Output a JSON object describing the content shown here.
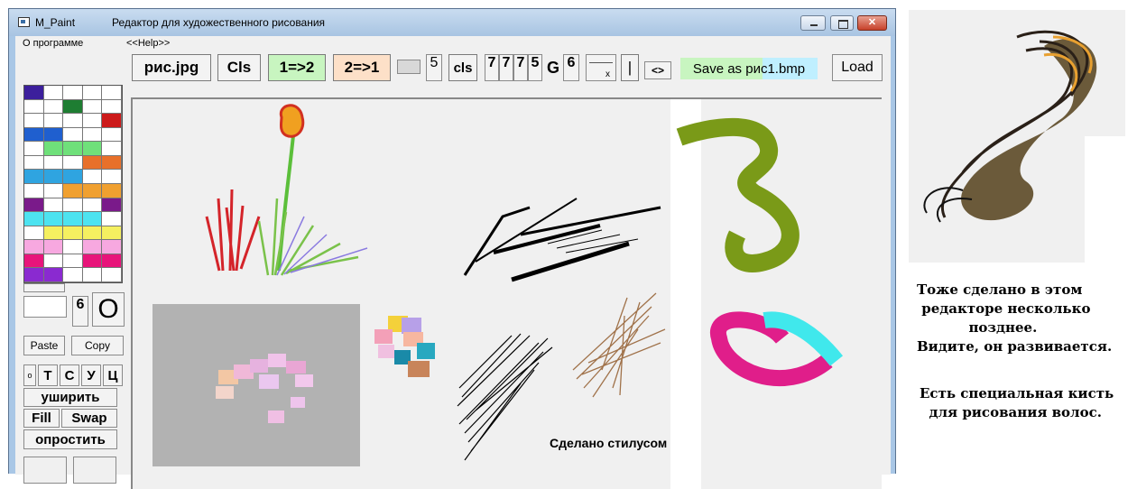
{
  "window": {
    "app_name": "M_Paint",
    "description": "Редактор для художественного рисования"
  },
  "menu": {
    "about": "О программе",
    "help": "<<Help>>"
  },
  "toolbar": {
    "open_jpg": "рис.jpg",
    "cls_upper": "Cls",
    "one_to_two": "1=>2",
    "two_to_one": "2=>1",
    "brush_size_value": "5",
    "cls_lower": "cls",
    "digits": [
      "7",
      "7",
      "7",
      "5"
    ],
    "g_label": "G",
    "g_value": "6",
    "x_label": "x",
    "bar_label": "|",
    "swap_arrows": "<>",
    "save_as": "Save as рис1.bmp",
    "load": "Load"
  },
  "left_panel": {
    "size_value": "6",
    "shape_label": "O",
    "paste": "Paste",
    "copy": "Copy",
    "letters": [
      "o",
      "Т",
      "С",
      "У",
      "Ц"
    ],
    "widen": "уширить",
    "fill": "Fill",
    "swap": "Swap",
    "simplify": "опростить"
  },
  "palette_colors": [
    "#3c1f9c",
    "#ffffff",
    "#ffffff",
    "#ffffff",
    "#ffffff",
    "#ffffff",
    "#ffffff",
    "#1e7d32",
    "#ffffff",
    "#ffffff",
    "#ffffff",
    "#ffffff",
    "#ffffff",
    "#ffffff",
    "#cc1a1a",
    "#1f5fcf",
    "#1f5fcf",
    "#ffffff",
    "#ffffff",
    "#ffffff",
    "#ffffff",
    "#6fe07a",
    "#6fe07a",
    "#6fe07a",
    "#ffffff",
    "#ffffff",
    "#ffffff",
    "#ffffff",
    "#e8702a",
    "#e8702a",
    "#2fa4e0",
    "#2fa4e0",
    "#2fa4e0",
    "#ffffff",
    "#ffffff",
    "#ffffff",
    "#ffffff",
    "#f0a030",
    "#f0a030",
    "#f0a030",
    "#7a1a8a",
    "#ffffff",
    "#ffffff",
    "#ffffff",
    "#7a1a8a",
    "#4de3f0",
    "#4de3f0",
    "#4de3f0",
    "#4de3f0",
    "#ffffff",
    "#ffffff",
    "#f5f060",
    "#f5f060",
    "#f5f060",
    "#f5f060",
    "#f7a8e0",
    "#f7a8e0",
    "#ffffff",
    "#f7a8e0",
    "#f7a8e0",
    "#e8147a",
    "#ffffff",
    "#ffffff",
    "#e8147a",
    "#e8147a",
    "#8a2ad0",
    "#8a2ad0",
    "#ffffff",
    "#ffffff",
    "#ffffff",
    "#ffffff",
    "#ffffff",
    "#7a9a2a",
    "#7a9a2a",
    "#ffffff",
    "#ffffff",
    "#1a8a9a",
    "#1a8a9a",
    "#ffffff",
    "#ffffff",
    "#000000",
    "#444444",
    "#777777",
    "#aaaaaa",
    "#ffffff"
  ],
  "canvas": {
    "stylus_caption": "Сделано стилусом"
  },
  "side_notes": {
    "note1": "Тоже сделано в этом\n редакторе несколько\n           позднее.\nВидите, он развивается.",
    "note2": "Есть специальная кисть\n  для рисования волос."
  }
}
